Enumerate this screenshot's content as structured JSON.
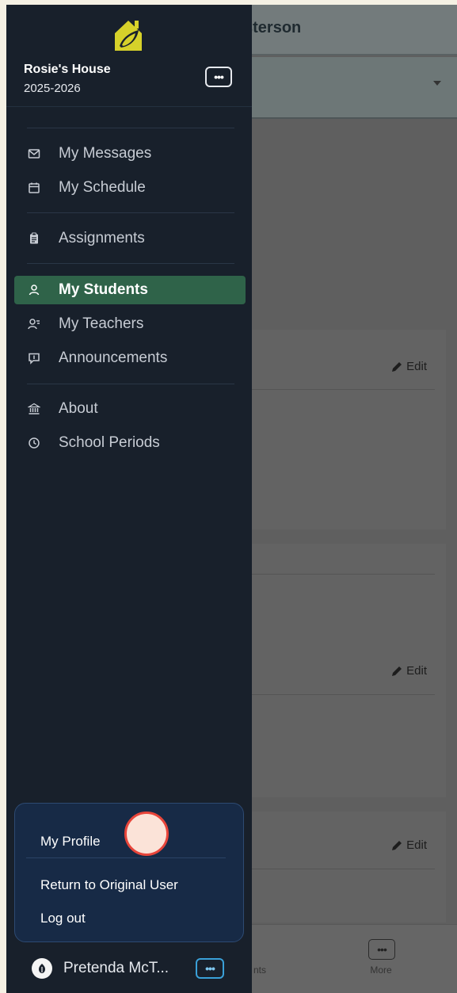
{
  "background": {
    "header_title": "sterson",
    "edit_label": "Edit",
    "bottom_nav": {
      "partial_label": "nts",
      "more_label": "More",
      "more_icon": "ellipsis-icon"
    }
  },
  "sidebar": {
    "logo_icon": "house-leaf-logo",
    "school_name": "Rosie's House",
    "school_year": "2025-2026",
    "menu_icon": "ellipsis-icon",
    "items": [
      {
        "label": "My Messages",
        "icon": "envelope-icon"
      },
      {
        "label": "My Schedule",
        "icon": "calendar-icon"
      },
      {
        "label": "Assignments",
        "icon": "clipboard-icon"
      },
      {
        "label": "My Students",
        "icon": "student-icon",
        "active": true
      },
      {
        "label": "My Teachers",
        "icon": "teacher-icon"
      },
      {
        "label": "Announcements",
        "icon": "megaphone-icon"
      },
      {
        "label": "About",
        "icon": "bank-icon"
      },
      {
        "label": "School Periods",
        "icon": "clock-icon"
      }
    ],
    "accent_color": "#2f6349"
  },
  "profile_menu": {
    "items": [
      "My Profile",
      "Return to Original User",
      "Log out"
    ]
  },
  "user": {
    "name": "Pretenda McT...",
    "avatar_icon": "user-avatar-icon",
    "menu_icon": "ellipsis-icon"
  }
}
